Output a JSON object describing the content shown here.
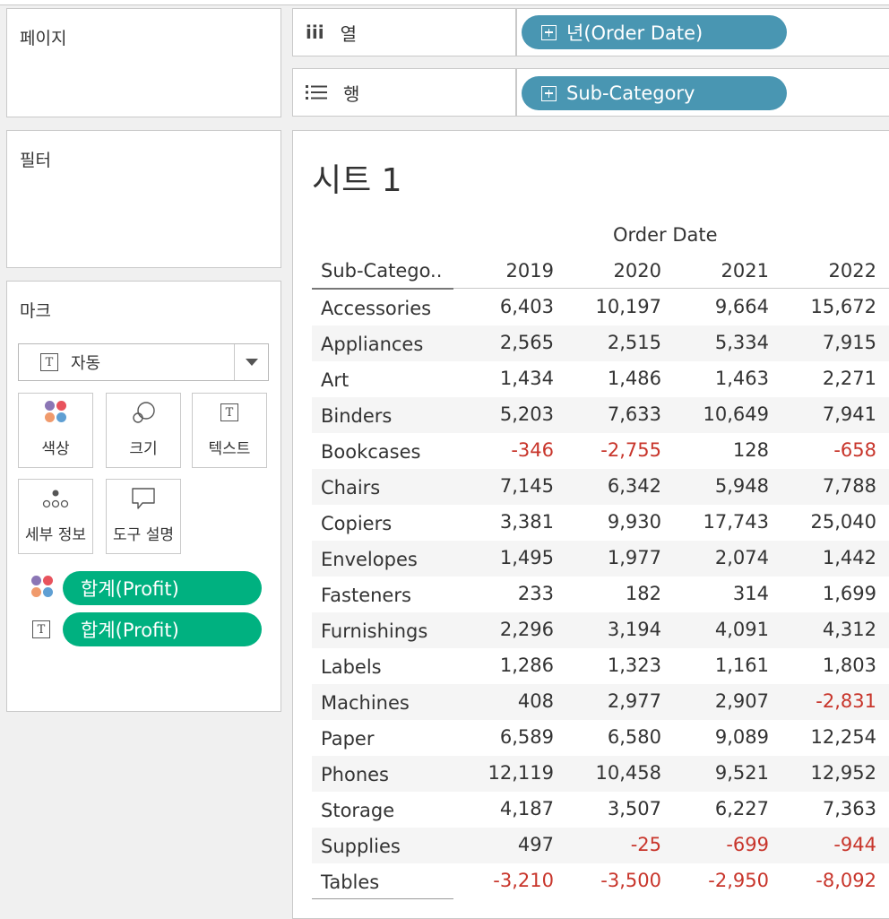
{
  "panels": {
    "pages_title": "페이지",
    "filters_title": "필터",
    "marks_title": "마크"
  },
  "shelves": {
    "columns_label": "열",
    "columns_pill": "년(Order Date)",
    "rows_label": "행",
    "rows_pill": "Sub-Category"
  },
  "marks": {
    "type": "자동",
    "buttons": {
      "color": "색상",
      "size": "크기",
      "text": "텍스트",
      "detail": "세부 정보",
      "tooltip": "도구 설명"
    },
    "fields": [
      "합계(Profit)",
      "합계(Profit)"
    ],
    "colors": {
      "dot_purple": "#8b76b5",
      "dot_red": "#e8535d",
      "dot_orange": "#f09a6c",
      "dot_blue": "#5f9fd3"
    }
  },
  "sheet": {
    "title": "시트 1",
    "column_group": "Order Date",
    "row_header": "Sub-Catego..",
    "years": [
      "2019",
      "2020",
      "2021",
      "2022"
    ]
  },
  "table": [
    {
      "cat": "Accessories",
      "v": [
        "6,403",
        "10,197",
        "9,664",
        "15,672"
      ]
    },
    {
      "cat": "Appliances",
      "v": [
        "2,565",
        "2,515",
        "5,334",
        "7,915"
      ]
    },
    {
      "cat": "Art",
      "v": [
        "1,434",
        "1,486",
        "1,463",
        "2,271"
      ]
    },
    {
      "cat": "Binders",
      "v": [
        "5,203",
        "7,633",
        "10,649",
        "7,941"
      ]
    },
    {
      "cat": "Bookcases",
      "v": [
        "-346",
        "-2,755",
        "128",
        "-658"
      ]
    },
    {
      "cat": "Chairs",
      "v": [
        "7,145",
        "6,342",
        "5,948",
        "7,788"
      ]
    },
    {
      "cat": "Copiers",
      "v": [
        "3,381",
        "9,930",
        "17,743",
        "25,040"
      ]
    },
    {
      "cat": "Envelopes",
      "v": [
        "1,495",
        "1,977",
        "2,074",
        "1,442"
      ]
    },
    {
      "cat": "Fasteners",
      "v": [
        "233",
        "182",
        "314",
        "1,699"
      ]
    },
    {
      "cat": "Furnishings",
      "v": [
        "2,296",
        "3,194",
        "4,091",
        "4,312"
      ]
    },
    {
      "cat": "Labels",
      "v": [
        "1,286",
        "1,323",
        "1,161",
        "1,803"
      ]
    },
    {
      "cat": "Machines",
      "v": [
        "408",
        "2,977",
        "2,907",
        "-2,831"
      ]
    },
    {
      "cat": "Paper",
      "v": [
        "6,589",
        "6,580",
        "9,089",
        "12,254"
      ]
    },
    {
      "cat": "Phones",
      "v": [
        "12,119",
        "10,458",
        "9,521",
        "12,952"
      ]
    },
    {
      "cat": "Storage",
      "v": [
        "4,187",
        "3,507",
        "6,227",
        "7,363"
      ]
    },
    {
      "cat": "Supplies",
      "v": [
        "497",
        "-25",
        "-699",
        "-944"
      ]
    },
    {
      "cat": "Tables",
      "v": [
        "-3,210",
        "-3,500",
        "-2,950",
        "-8,092"
      ]
    }
  ],
  "colors": {
    "pill_blue": "#4996b2",
    "pill_green": "#00b180",
    "negative": "#c8352b"
  }
}
